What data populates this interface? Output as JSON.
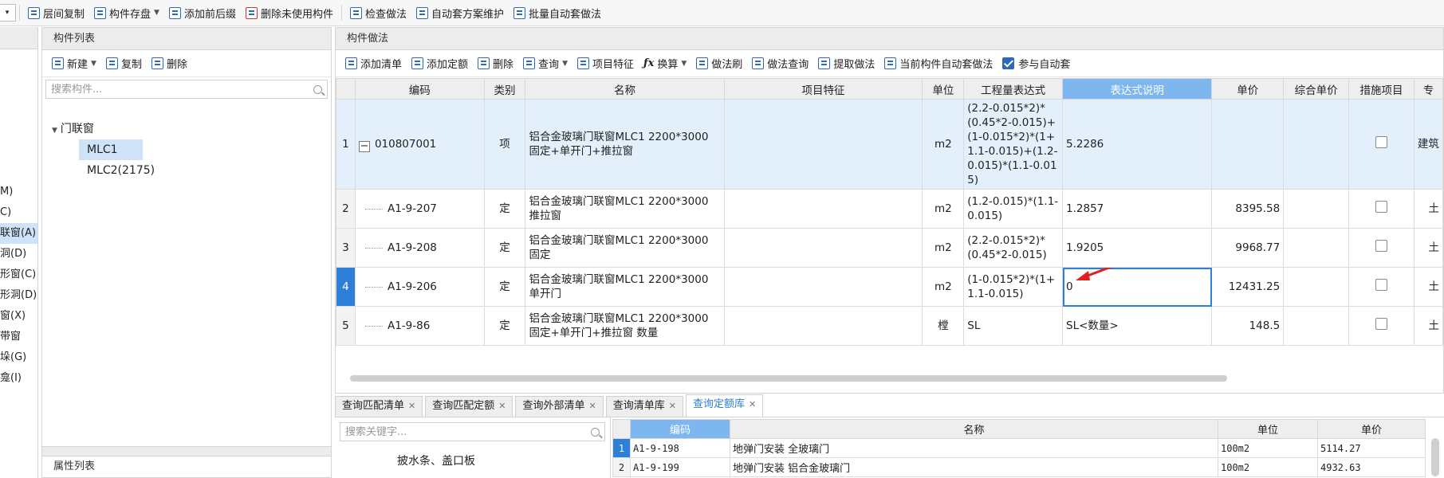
{
  "toolbar": {
    "items": [
      {
        "label": "层间复制"
      },
      {
        "label": "构件存盘"
      },
      {
        "label": "添加前后缀"
      },
      {
        "label": "删除未使用构件"
      },
      {
        "label": "检查做法"
      },
      {
        "label": "自动套方案维护"
      },
      {
        "label": "批量自动套做法"
      }
    ]
  },
  "left_stub": {
    "items": [
      "M)",
      "C)",
      "联窗(A)",
      "洞(D)",
      "形窗(C)",
      "形洞(D)",
      "窗(X)",
      "带窗",
      "垛(G)",
      "龛(I)"
    ]
  },
  "component_list": {
    "title": "构件列表",
    "new_label": "新建",
    "copy_label": "复制",
    "delete_label": "删除",
    "search_placeholder": "搜索构件...",
    "tree": {
      "group": "门联窗",
      "items": [
        "MLC1",
        "MLC2(2175)"
      ],
      "selected": "MLC1"
    }
  },
  "attr_panel": {
    "title": "属性列表"
  },
  "method_panel": {
    "title": "构件做法",
    "toolbar": {
      "add_list": "添加清单",
      "add_quota": "添加定额",
      "delete": "删除",
      "query": "查询",
      "item_feature": "项目特征",
      "convert": "换算",
      "method_brush": "做法刷",
      "method_query": "做法查询",
      "extract_method": "提取做法",
      "auto_apply_current": "当前构件自动套做法",
      "join_auto": "参与自动套"
    },
    "columns": [
      "编码",
      "类别",
      "名称",
      "项目特征",
      "单位",
      "工程量表达式",
      "表达式说明",
      "单价",
      "综合单价",
      "措施项目",
      "专"
    ],
    "rows": [
      {
        "no": "1",
        "code": "010807001",
        "type": "项",
        "name": "铝合金玻璃门联窗MLC1 2200*3000 固定+单开门+推拉窗",
        "feature": "",
        "unit": "m2",
        "expr": "(2.2-0.015*2)*(0.45*2-0.015)+(1-0.015*2)*(1+1.1-0.015)+(1.2-0.015)*(1.1-0.015)",
        "desc": "5.2286",
        "price": "",
        "comp_price": "",
        "measure": "",
        "spec": "建筑"
      },
      {
        "no": "2",
        "code": "A1-9-207",
        "type": "定",
        "name": "铝合金玻璃门联窗MLC1 2200*3000 推拉窗",
        "feature": "",
        "unit": "m2",
        "expr": "(1.2-0.015)*(1.1-0.015)",
        "desc": "1.2857",
        "price": "8395.58",
        "comp_price": "",
        "measure": "",
        "spec": "土"
      },
      {
        "no": "3",
        "code": "A1-9-208",
        "type": "定",
        "name": "铝合金玻璃门联窗MLC1 2200*3000 固定",
        "feature": "",
        "unit": "m2",
        "expr": "(2.2-0.015*2)*(0.45*2-0.015)",
        "desc": "1.9205",
        "price": "9968.77",
        "comp_price": "",
        "measure": "",
        "spec": "土"
      },
      {
        "no": "4",
        "code": "A1-9-206",
        "type": "定",
        "name": "铝合金玻璃门联窗MLC1 2200*3000 单开门",
        "feature": "",
        "unit": "m2",
        "expr": "(1-0.015*2)*(1+1.1-0.015)",
        "desc": "0",
        "price": "12431.25",
        "comp_price": "",
        "measure": "",
        "spec": "土"
      },
      {
        "no": "5",
        "code": "A1-9-86",
        "type": "定",
        "name": "铝合金玻璃门联窗MLC1 2200*3000 固定+单开门+推拉窗 数量",
        "feature": "",
        "unit": "樘",
        "expr": "SL",
        "desc": "SL<数量>",
        "price": "148.5",
        "comp_price": "",
        "measure": "",
        "spec": "土"
      }
    ]
  },
  "bottom_tabs": [
    {
      "label": "查询匹配清单"
    },
    {
      "label": "查询匹配定额"
    },
    {
      "label": "查询外部清单"
    },
    {
      "label": "查询清单库"
    },
    {
      "label": "查询定额库"
    }
  ],
  "bottom_left": {
    "search_placeholder": "搜索关键字...",
    "tree_item": "披水条、盖口板"
  },
  "quota_table": {
    "columns": [
      "编码",
      "名称",
      "单位",
      "单价"
    ],
    "rows": [
      {
        "no": "1",
        "code": "A1-9-198",
        "name": "地弹门安装 全玻璃门",
        "unit": "100m2",
        "price": "5114.27"
      },
      {
        "no": "2",
        "code": "A1-9-199",
        "name": "地弹门安装 铝合金玻璃门",
        "unit": "100m2",
        "price": "4932.63"
      }
    ]
  }
}
